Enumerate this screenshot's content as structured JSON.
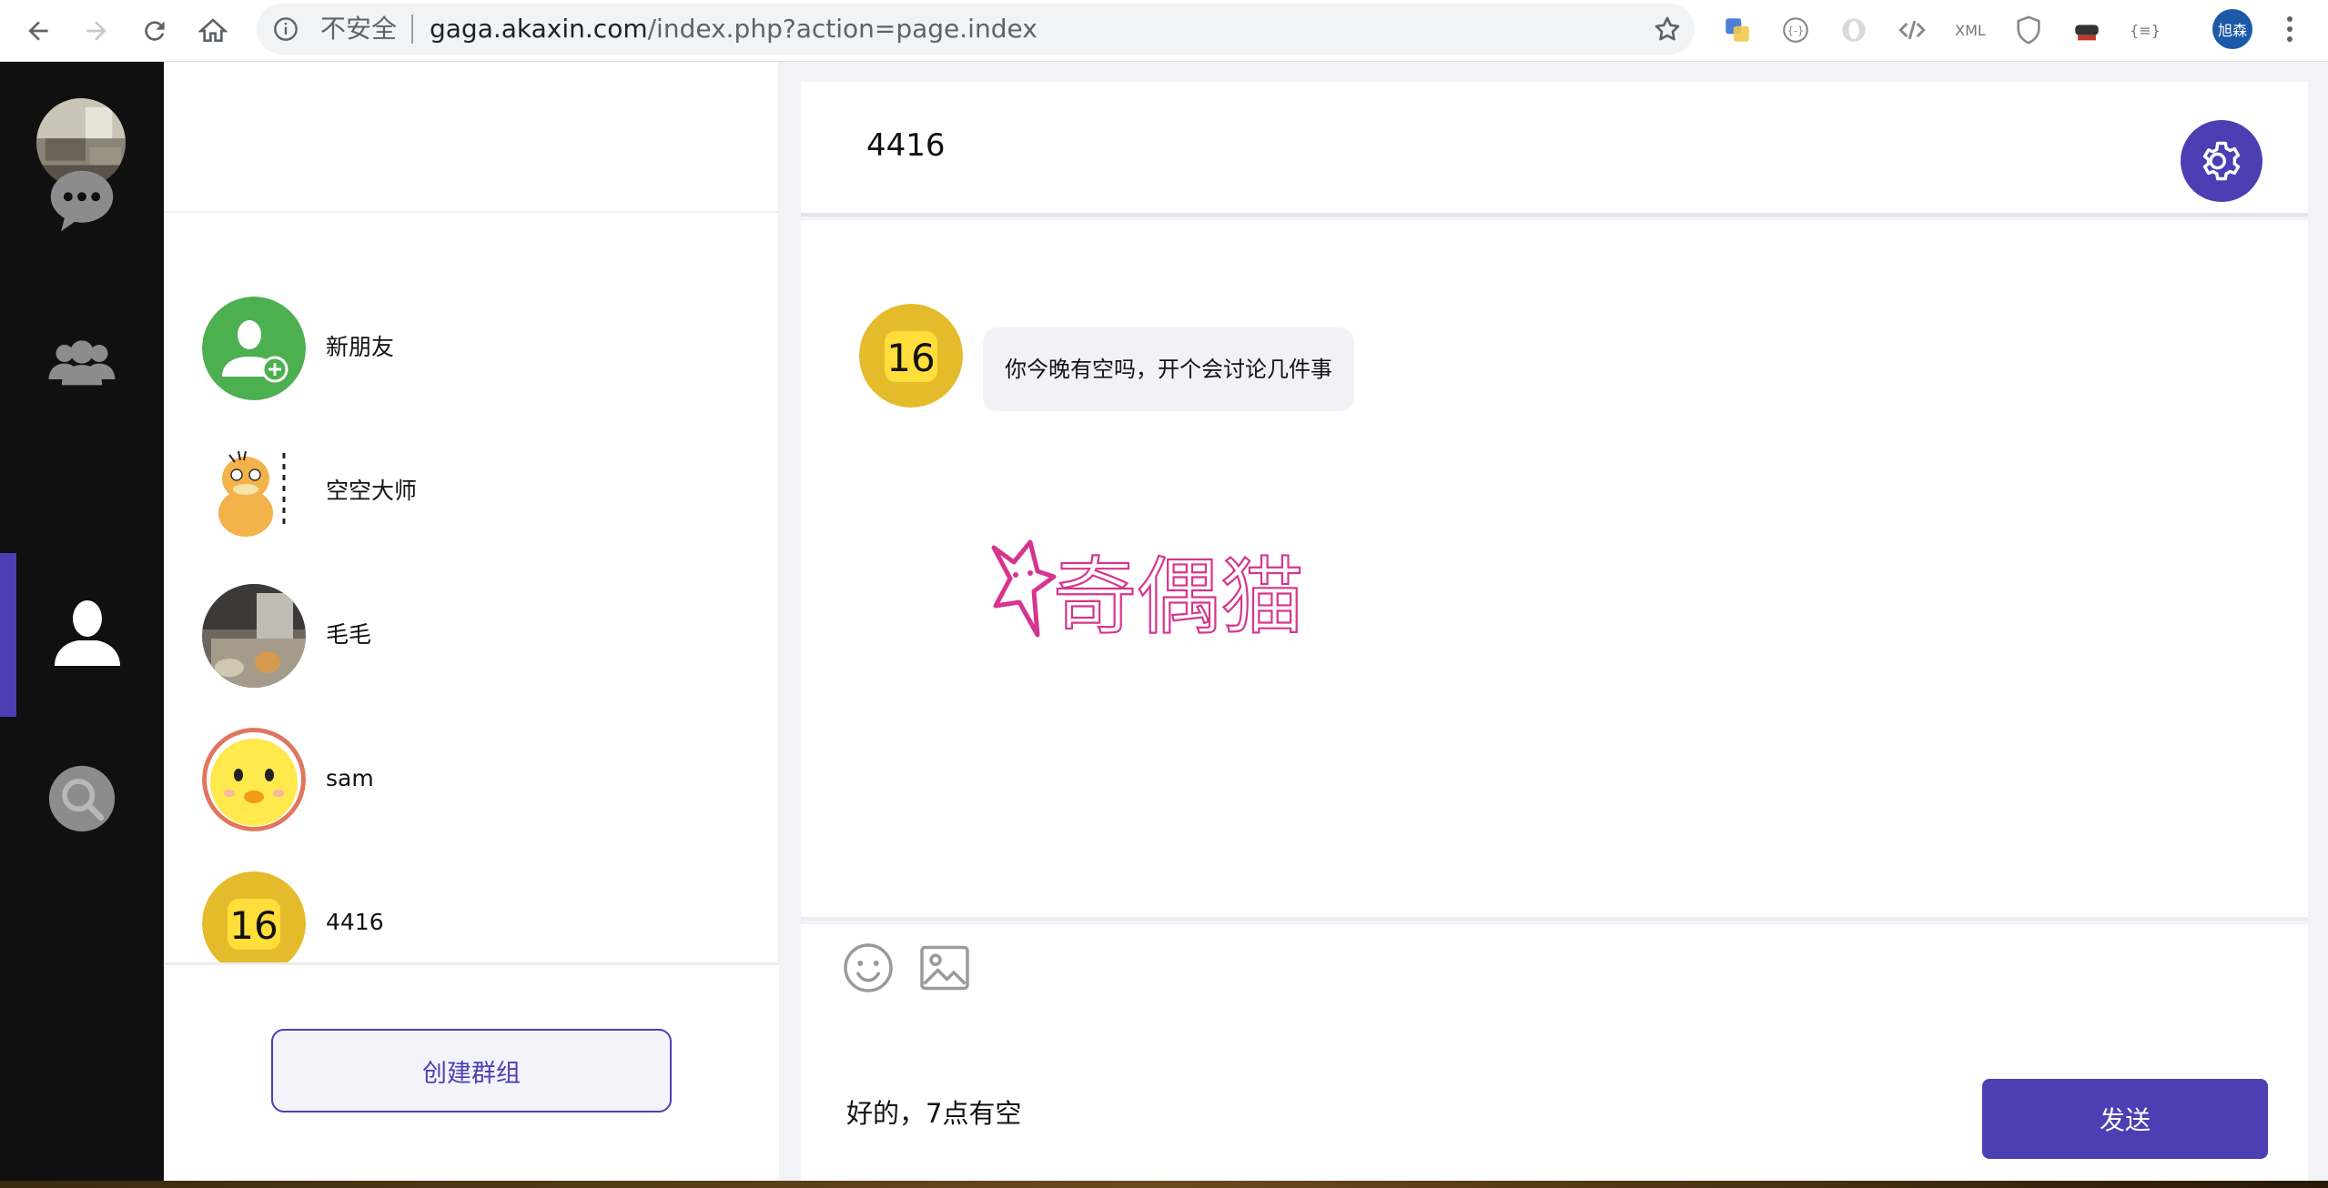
{
  "browser": {
    "insecure_label": "不安全",
    "url_host": "gaga.akaxin.com",
    "url_path": "/index.php?action=page.index",
    "profile_label": "旭森",
    "ext_xml_label": "XML",
    "ext_json_label": "{≡}"
  },
  "leftnav": {
    "items": [
      {
        "name": "chat",
        "icon": "chat-bubble-icon"
      },
      {
        "name": "groups",
        "icon": "group-icon"
      },
      {
        "name": "contacts",
        "icon": "person-icon",
        "active": true
      },
      {
        "name": "search",
        "icon": "search-icon"
      }
    ],
    "active_color": "#4c3fb3"
  },
  "contacts": {
    "items": [
      {
        "name": "新朋友",
        "avatar": "add-friend-icon"
      },
      {
        "name": "空空大师",
        "avatar": "duck-cartoon-avatar"
      },
      {
        "name": "毛毛",
        "avatar": "photo-avatar"
      },
      {
        "name": "sam",
        "avatar": "chick-cartoon-avatar"
      },
      {
        "name": "4416",
        "avatar": "number-16-avatar"
      }
    ],
    "create_group_label": "创建群组"
  },
  "chat": {
    "title": "4416",
    "messages": [
      {
        "avatar_text": "16",
        "text": "你今晚有空吗，开个会讨论几件事"
      },
      {
        "avatar_text": "",
        "sticker": "cat-logo-sticker",
        "sticker_text": "奇偶猫"
      }
    ],
    "input_value": "好的，7点有空",
    "send_label": "发送",
    "accent_color": "#4c3fb3",
    "sticker_color": "#d6358f"
  }
}
